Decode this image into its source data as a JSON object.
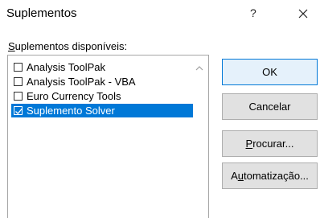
{
  "dialog": {
    "title": "Suplementos",
    "help": "?",
    "list_label_accel": "S",
    "list_label_rest": "uplementos disponíveis:"
  },
  "addins": [
    {
      "label": "Analysis ToolPak",
      "checked": false
    },
    {
      "label": "Analysis ToolPak - VBA",
      "checked": false
    },
    {
      "label": "Euro Currency Tools",
      "checked": false
    },
    {
      "label": "Suplemento Solver",
      "checked": true,
      "selected": true
    }
  ],
  "buttons": {
    "ok": "OK",
    "cancel": "Cancelar",
    "browse_accel": "P",
    "browse_rest": "rocurar...",
    "automation_pre": "A",
    "automation_accel": "u",
    "automation_rest": "tomatização..."
  },
  "colors": {
    "selection": "#0078d7",
    "default_button_border": "#0078d7",
    "default_button_fill": "#e5f1fb",
    "button_fill": "#e1e1e1"
  },
  "icons": {
    "close": "close-icon",
    "scroll_up": "chevron-up-icon",
    "checkmark": "checkmark-icon"
  }
}
